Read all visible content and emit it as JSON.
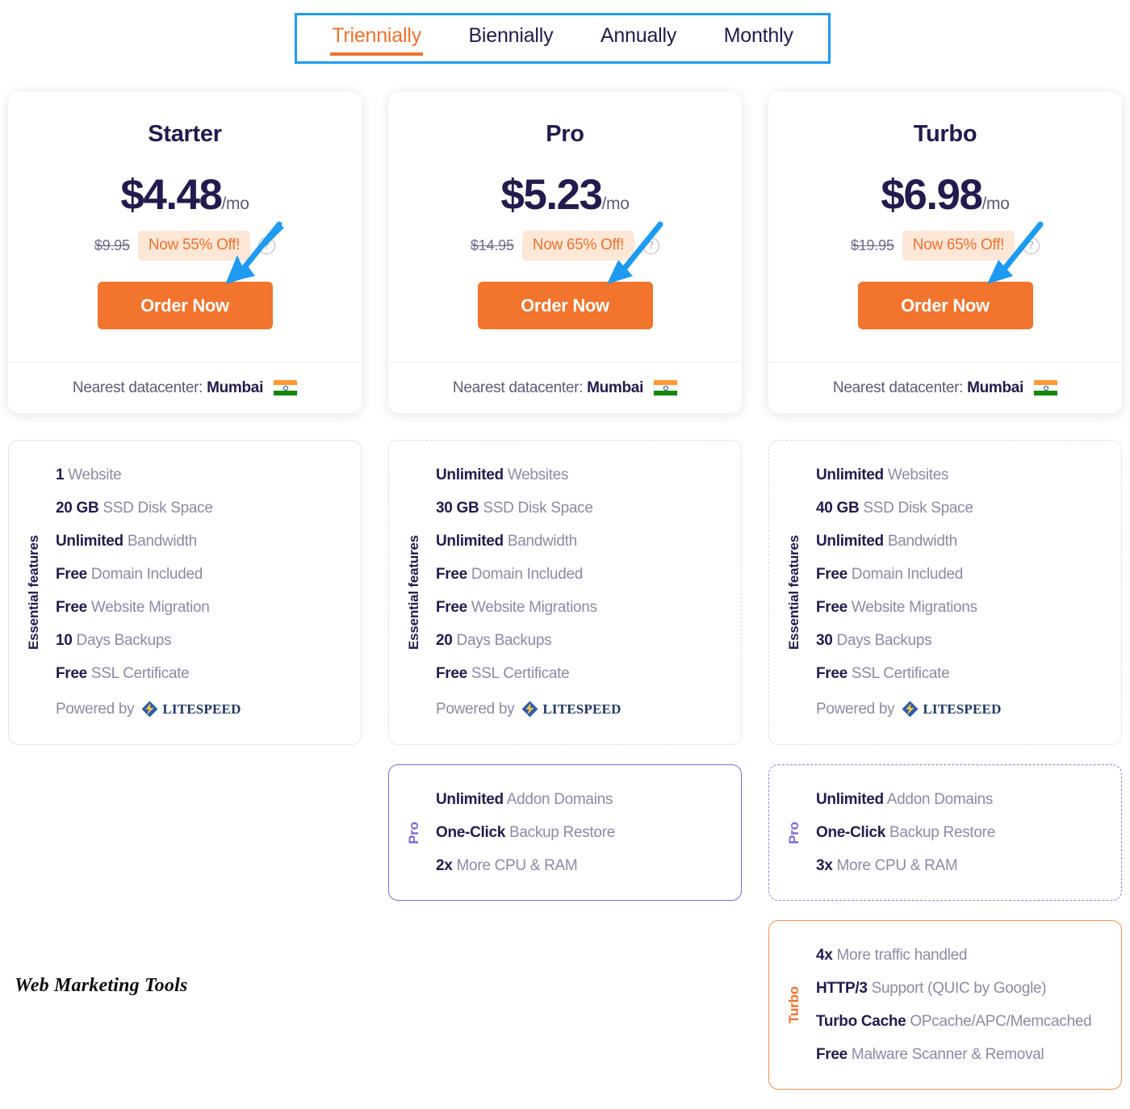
{
  "billing_tabs": {
    "options": [
      {
        "label": "Triennially",
        "active": true
      },
      {
        "label": "Biennially",
        "active": false
      },
      {
        "label": "Annually",
        "active": false
      },
      {
        "label": "Monthly",
        "active": false
      }
    ],
    "selected": "Triennially",
    "highlight_color": "#1e9bf0",
    "active_color": "#f2712c"
  },
  "accent_colors": {
    "orange": "#f2712c",
    "button_orange": "#f2742d",
    "badge_bg": "#fde7d7",
    "navy": "#231b4e",
    "purple": "#7a6cd6",
    "annotation_blue": "#1e9bf0"
  },
  "plans": [
    {
      "name": "Starter",
      "price": "$4.48",
      "price_suffix": "/mo",
      "old_price": "$9.95",
      "discount_badge": "Now 55% Off!",
      "help_icon": "question-circle-icon",
      "order_label": "Order Now",
      "datacenter_label": "Nearest datacenter:",
      "datacenter_city": "Mumbai",
      "datacenter_flag": "india-flag-icon",
      "essential": {
        "label": "Essential features",
        "border": "solid",
        "items": [
          {
            "strong": "1",
            "rest": " Website"
          },
          {
            "strong": "20 GB",
            "rest": " SSD Disk Space"
          },
          {
            "strong": "Unlimited",
            "rest": " Bandwidth"
          },
          {
            "strong": "Free",
            "rest": " Domain Included"
          },
          {
            "strong": "Free",
            "rest": " Website Migration"
          },
          {
            "strong": "10",
            "rest": " Days Backups"
          },
          {
            "strong": "Free",
            "rest": " SSL Certificate"
          }
        ],
        "powered_by_label": "Powered by",
        "powered_by_logo": "LITESPEED"
      },
      "extra_boxes": []
    },
    {
      "name": "Pro",
      "price": "$5.23",
      "price_suffix": "/mo",
      "old_price": "$14.95",
      "discount_badge": "Now 65% Off!",
      "help_icon": "question-circle-icon",
      "order_label": "Order Now",
      "datacenter_label": "Nearest datacenter:",
      "datacenter_city": "Mumbai",
      "datacenter_flag": "india-flag-icon",
      "essential": {
        "label": "Essential features",
        "border": "dashed",
        "items": [
          {
            "strong": "Unlimited",
            "rest": " Websites"
          },
          {
            "strong": "30 GB",
            "rest": " SSD Disk Space"
          },
          {
            "strong": "Unlimited",
            "rest": " Bandwidth"
          },
          {
            "strong": "Free",
            "rest": " Domain Included"
          },
          {
            "strong": "Free",
            "rest": " Website Migrations"
          },
          {
            "strong": "20",
            "rest": " Days Backups"
          },
          {
            "strong": "Free",
            "rest": " SSL Certificate"
          }
        ],
        "powered_by_label": "Powered by",
        "powered_by_logo": "LITESPEED"
      },
      "extra_boxes": [
        {
          "label": "Pro",
          "tier": "pro",
          "border": "solid",
          "items": [
            {
              "strong": "Unlimited",
              "rest": " Addon Domains"
            },
            {
              "strong": "One-Click",
              "rest": " Backup Restore"
            },
            {
              "strong": "2x",
              "rest": " More CPU & RAM"
            }
          ]
        }
      ]
    },
    {
      "name": "Turbo",
      "price": "$6.98",
      "price_suffix": "/mo",
      "old_price": "$19.95",
      "discount_badge": "Now 65% Off!",
      "help_icon": "question-circle-icon",
      "order_label": "Order Now",
      "datacenter_label": "Nearest datacenter:",
      "datacenter_city": "Mumbai",
      "datacenter_flag": "india-flag-icon",
      "essential": {
        "label": "Essential features",
        "border": "dashed",
        "items": [
          {
            "strong": "Unlimited",
            "rest": " Websites"
          },
          {
            "strong": "40 GB",
            "rest": " SSD Disk Space"
          },
          {
            "strong": "Unlimited",
            "rest": " Bandwidth"
          },
          {
            "strong": "Free",
            "rest": " Domain Included"
          },
          {
            "strong": "Free",
            "rest": " Website Migrations"
          },
          {
            "strong": "30",
            "rest": " Days Backups"
          },
          {
            "strong": "Free",
            "rest": " SSL Certificate"
          }
        ],
        "powered_by_label": "Powered by",
        "powered_by_logo": "LITESPEED"
      },
      "extra_boxes": [
        {
          "label": "Pro",
          "tier": "pro",
          "border": "dashed",
          "items": [
            {
              "strong": "Unlimited",
              "rest": " Addon Domains"
            },
            {
              "strong": "One-Click",
              "rest": " Backup Restore"
            },
            {
              "strong": "3x",
              "rest": " More CPU & RAM"
            }
          ]
        },
        {
          "label": "Turbo",
          "tier": "turbo",
          "border": "solid",
          "items": [
            {
              "strong": "4x",
              "rest": " More traffic handled"
            },
            {
              "strong": "HTTP/3",
              "rest": " Support (QUIC by Google)"
            },
            {
              "strong": "Turbo Cache",
              "rest": " OPcache/APC/Memcached"
            },
            {
              "strong": "Free",
              "rest": " Malware Scanner & Removal"
            }
          ]
        }
      ]
    }
  ],
  "watermark": "Web Marketing Tools"
}
